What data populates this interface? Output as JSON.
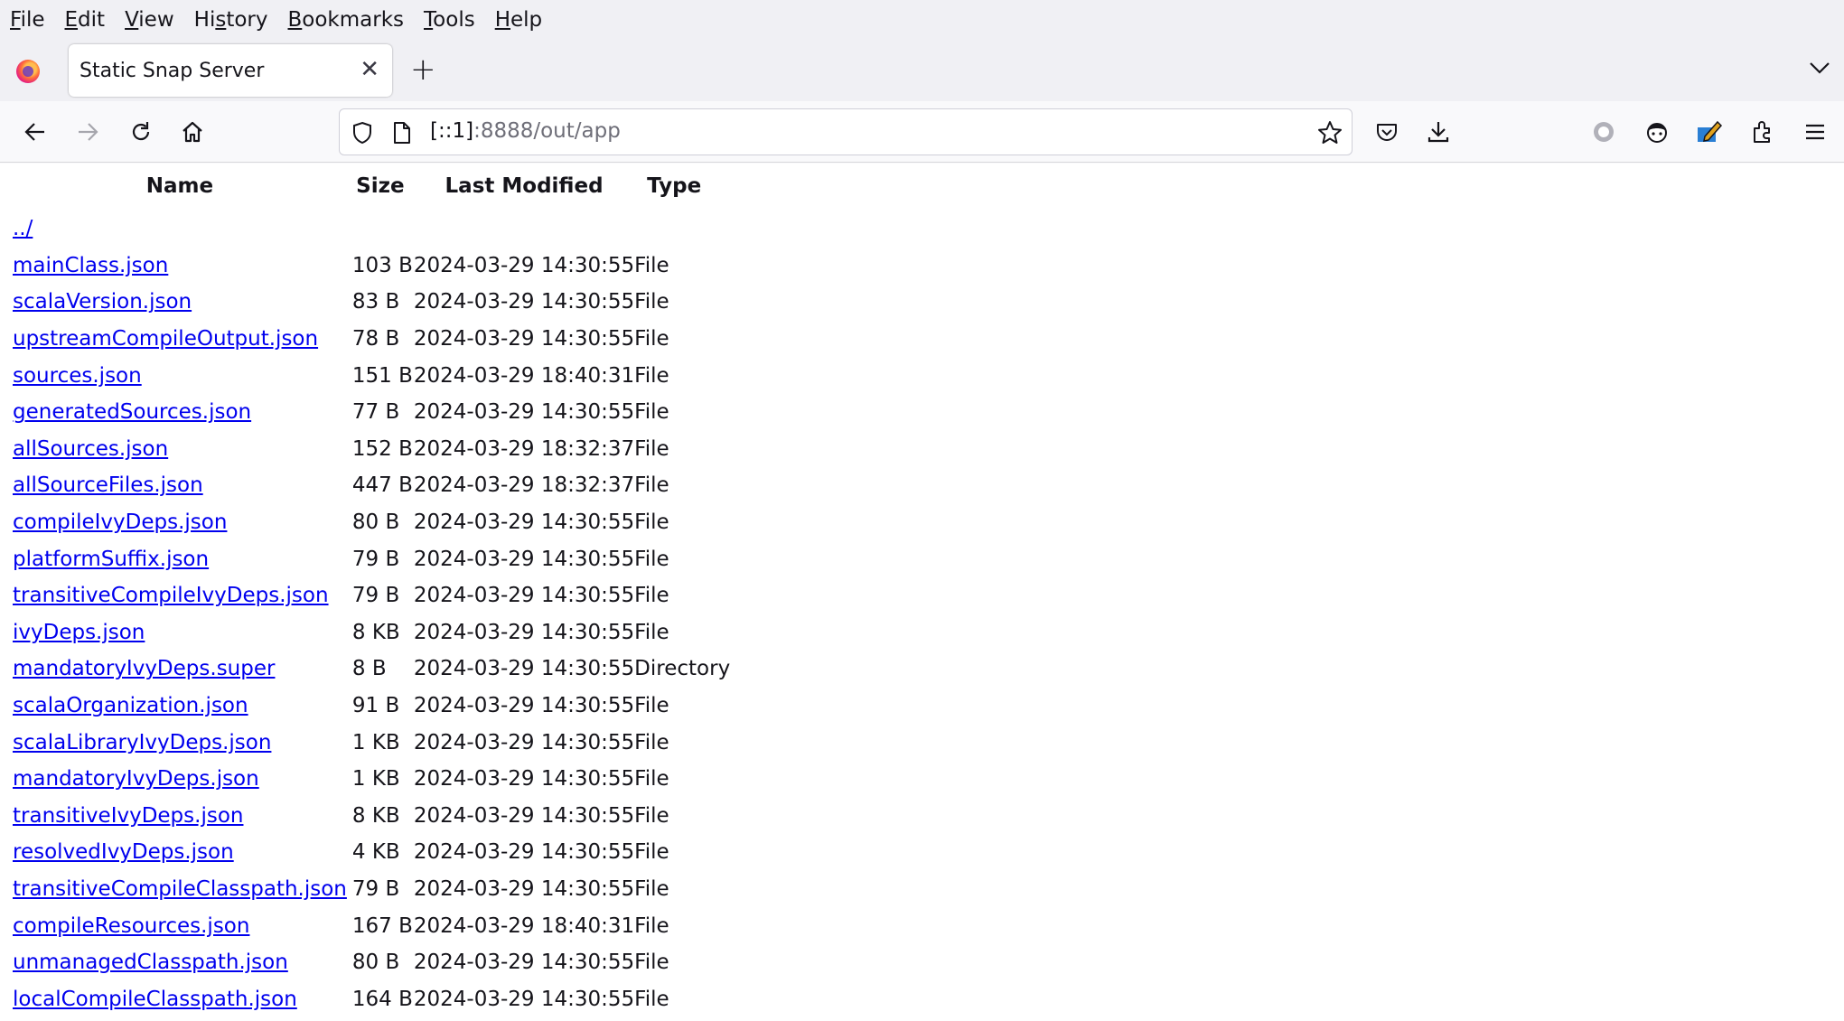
{
  "menubar": {
    "items": [
      {
        "pre": "",
        "key": "F",
        "post": "ile"
      },
      {
        "pre": "",
        "key": "E",
        "post": "dit"
      },
      {
        "pre": "",
        "key": "V",
        "post": "iew"
      },
      {
        "pre": "Hi",
        "key": "s",
        "post": "tory"
      },
      {
        "pre": "",
        "key": "B",
        "post": "ookmarks"
      },
      {
        "pre": "",
        "key": "T",
        "post": "ools"
      },
      {
        "pre": "",
        "key": "H",
        "post": "elp"
      }
    ]
  },
  "tab": {
    "title": "Static Snap Server",
    "close": "✕"
  },
  "newtab": "+",
  "url": {
    "host": "[::1]",
    "rest": ":8888/out/app"
  },
  "listing": {
    "headers": {
      "name": "Name",
      "size": "Size",
      "modified": "Last Modified",
      "type": "Type"
    },
    "parent": "../",
    "rows": [
      {
        "name": "mainClass.json",
        "size": "103 B",
        "modified": "2024-03-29 14:30:55",
        "type": "File"
      },
      {
        "name": "scalaVersion.json",
        "size": "83 B",
        "modified": "2024-03-29 14:30:55",
        "type": "File"
      },
      {
        "name": "upstreamCompileOutput.json",
        "size": "78 B",
        "modified": "2024-03-29 14:30:55",
        "type": "File"
      },
      {
        "name": "sources.json",
        "size": "151 B",
        "modified": "2024-03-29 18:40:31",
        "type": "File"
      },
      {
        "name": "generatedSources.json",
        "size": "77 B",
        "modified": "2024-03-29 14:30:55",
        "type": "File"
      },
      {
        "name": "allSources.json",
        "size": "152 B",
        "modified": "2024-03-29 18:32:37",
        "type": "File"
      },
      {
        "name": "allSourceFiles.json",
        "size": "447 B",
        "modified": "2024-03-29 18:32:37",
        "type": "File"
      },
      {
        "name": "compileIvyDeps.json",
        "size": "80 B",
        "modified": "2024-03-29 14:30:55",
        "type": "File"
      },
      {
        "name": "platformSuffix.json",
        "size": "79 B",
        "modified": "2024-03-29 14:30:55",
        "type": "File"
      },
      {
        "name": "transitiveCompileIvyDeps.json",
        "size": "79 B",
        "modified": "2024-03-29 14:30:55",
        "type": "File"
      },
      {
        "name": "ivyDeps.json",
        "size": "8 KB",
        "modified": "2024-03-29 14:30:55",
        "type": "File"
      },
      {
        "name": "mandatoryIvyDeps.super",
        "size": "8 B",
        "modified": "2024-03-29 14:30:55",
        "type": "Directory"
      },
      {
        "name": "scalaOrganization.json",
        "size": "91 B",
        "modified": "2024-03-29 14:30:55",
        "type": "File"
      },
      {
        "name": "scalaLibraryIvyDeps.json",
        "size": "1 KB",
        "modified": "2024-03-29 14:30:55",
        "type": "File"
      },
      {
        "name": "mandatoryIvyDeps.json",
        "size": "1 KB",
        "modified": "2024-03-29 14:30:55",
        "type": "File"
      },
      {
        "name": "transitiveIvyDeps.json",
        "size": "8 KB",
        "modified": "2024-03-29 14:30:55",
        "type": "File"
      },
      {
        "name": "resolvedIvyDeps.json",
        "size": "4 KB",
        "modified": "2024-03-29 14:30:55",
        "type": "File"
      },
      {
        "name": "transitiveCompileClasspath.json",
        "size": "79 B",
        "modified": "2024-03-29 14:30:55",
        "type": "File"
      },
      {
        "name": "compileResources.json",
        "size": "167 B",
        "modified": "2024-03-29 18:40:31",
        "type": "File"
      },
      {
        "name": "unmanagedClasspath.json",
        "size": "80 B",
        "modified": "2024-03-29 14:30:55",
        "type": "File"
      },
      {
        "name": "localCompileClasspath.json",
        "size": "164 B",
        "modified": "2024-03-29 14:30:55",
        "type": "File"
      }
    ]
  },
  "icons": {
    "nav": [
      "back-icon",
      "forward-icon",
      "reload-icon",
      "home-icon"
    ],
    "urlbar": [
      "shield-icon",
      "page-icon",
      "star-icon"
    ],
    "toolbar": [
      "pocket-icon",
      "download-icon",
      "record-icon",
      "avatar-extension-icon",
      "pencil-extension-icon",
      "extensions-icon",
      "hamburger-menu-icon"
    ]
  }
}
